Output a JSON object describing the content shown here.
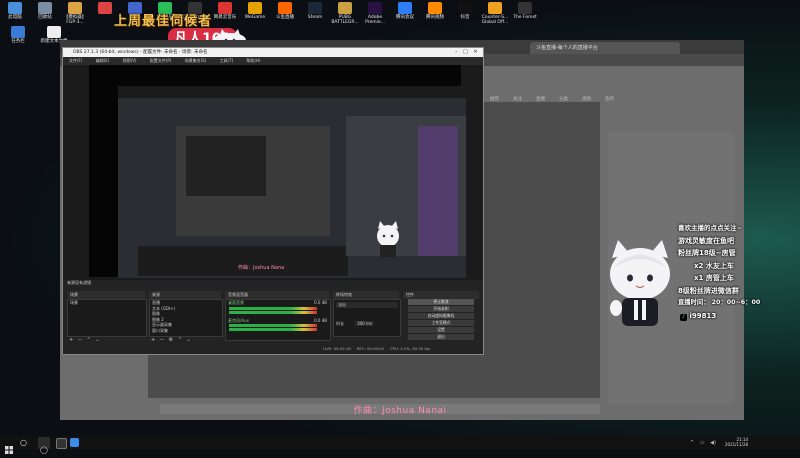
{
  "desktop": {
    "icons": [
      {
        "label": "此电脑",
        "color": "#4a90d9"
      },
      {
        "label": "回收站",
        "color": "#7a8da3"
      },
      {
        "label": "【模拟器】 FGP-3...",
        "color": "#d9a441"
      },
      {
        "label": "",
        "color": "#d44"
      },
      {
        "label": "",
        "color": "#46c"
      },
      {
        "label": "QQ音乐",
        "color": "#2bbd5a"
      },
      {
        "label": "OBS Studio",
        "color": "#333"
      },
      {
        "label": "网易云音乐",
        "color": "#d33"
      },
      {
        "label": "WeGame",
        "color": "#e5a300"
      },
      {
        "label": "斗鱼直播",
        "color": "#f60"
      },
      {
        "label": "Steam",
        "color": "#1b2838"
      },
      {
        "label": "PUBG BATTLEGR...",
        "color": "#caa042"
      },
      {
        "label": "Adobe Premie...",
        "color": "#2a1145"
      },
      {
        "label": "腾讯会议",
        "color": "#2e7df6"
      },
      {
        "label": "腾讯视频",
        "color": "#ff8a00"
      },
      {
        "label": "抖音",
        "color": "#111"
      },
      {
        "label": "Counter-S... Global Off...",
        "color": "#f0a020"
      },
      {
        "label": "The Forest",
        "color": "#333"
      }
    ],
    "left_icons": [
      {
        "label": "任务栏",
        "color": "#3a7bd5"
      },
      {
        "label": "新建文本文档",
        "color": "#eee"
      }
    ]
  },
  "overlay": {
    "banner_title": "上周最佳伺候者",
    "badge": "凡人109",
    "info_lines": [
      "喜欢主播的点点关注~",
      "游戏灵敏度在鱼吧",
      "粉丝牌18级~房管",
      "x2 水友上车",
      "x1 房管上车",
      "8级粉丝牌进微信群",
      "直播时间： 20：00~6：00",
      "i99813"
    ],
    "subtitle": "作曲：Joshua Nanai"
  },
  "obs": {
    "title": "OBS 27.1.3 (64-bit, windows) - 配置文件: 未命名 - 场景: 未命名",
    "menu": [
      "文件(F)",
      "编辑(E)",
      "视图(V)",
      "配置文件(P)",
      "场景集合(S)",
      "工具(T)",
      "帮助(H)"
    ],
    "preview_caption": "作曲：Joshua Nana",
    "panels": {
      "scenes": "场景",
      "sources": "来源",
      "mixer": "音频混音器",
      "transitions": "转场特效",
      "controls": "控件"
    },
    "source_filter_label": "来源没有滤镜",
    "sources_list": [
      "直播",
      "文本 (GDI+)",
      "图像",
      "图像 2",
      "显示器采集",
      "窗口采集"
    ],
    "scenes_list": [
      "场景"
    ],
    "mixer_tracks": [
      {
        "name": "桌面音频",
        "db": "0.0 dB"
      },
      {
        "name": "麦克风/Aux",
        "db": "0.0 dB"
      }
    ],
    "transition": {
      "name": "淡出",
      "duration_label": "时长",
      "duration": "300 ms"
    },
    "controls": [
      "停止推流",
      "开始录制",
      "启动虚拟摄像机",
      "工作室模式",
      "设置",
      "退出"
    ],
    "status": [
      "LIVE: 00:02:16",
      "REC: 00:00:00",
      "CPU: 4.2%, 60.00 fps"
    ]
  },
  "browser": {
    "tab_title": "斗鱼直播-每个人的直播平台",
    "sidebar_items": [
      "推荐",
      "关注",
      "直播",
      "分类",
      "视频",
      "鱼吧"
    ]
  },
  "taskbar": {
    "time": "21:14",
    "date": "2021/11/28"
  }
}
